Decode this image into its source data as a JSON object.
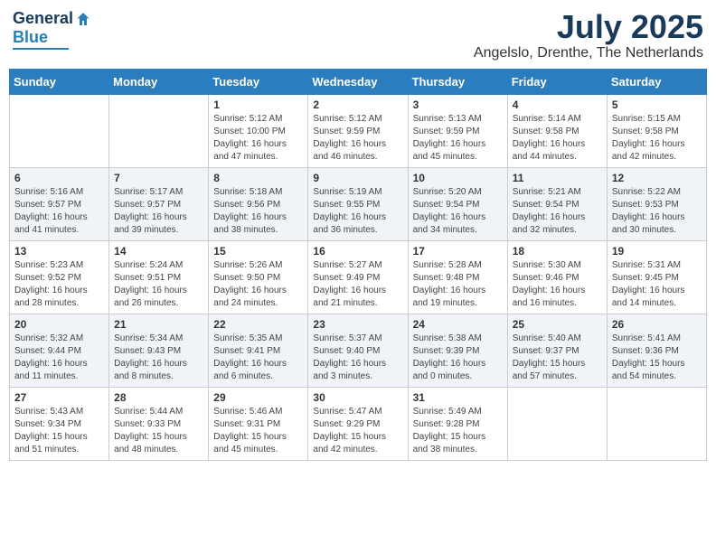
{
  "header": {
    "logo_general": "General",
    "logo_blue": "Blue",
    "month_title": "July 2025",
    "location": "Angelslo, Drenthe, The Netherlands"
  },
  "weekdays": [
    "Sunday",
    "Monday",
    "Tuesday",
    "Wednesday",
    "Thursday",
    "Friday",
    "Saturday"
  ],
  "weeks": [
    [
      {
        "day": "",
        "info": ""
      },
      {
        "day": "",
        "info": ""
      },
      {
        "day": "1",
        "info": "Sunrise: 5:12 AM\nSunset: 10:00 PM\nDaylight: 16 hours\nand 47 minutes."
      },
      {
        "day": "2",
        "info": "Sunrise: 5:12 AM\nSunset: 9:59 PM\nDaylight: 16 hours\nand 46 minutes."
      },
      {
        "day": "3",
        "info": "Sunrise: 5:13 AM\nSunset: 9:59 PM\nDaylight: 16 hours\nand 45 minutes."
      },
      {
        "day": "4",
        "info": "Sunrise: 5:14 AM\nSunset: 9:58 PM\nDaylight: 16 hours\nand 44 minutes."
      },
      {
        "day": "5",
        "info": "Sunrise: 5:15 AM\nSunset: 9:58 PM\nDaylight: 16 hours\nand 42 minutes."
      }
    ],
    [
      {
        "day": "6",
        "info": "Sunrise: 5:16 AM\nSunset: 9:57 PM\nDaylight: 16 hours\nand 41 minutes."
      },
      {
        "day": "7",
        "info": "Sunrise: 5:17 AM\nSunset: 9:57 PM\nDaylight: 16 hours\nand 39 minutes."
      },
      {
        "day": "8",
        "info": "Sunrise: 5:18 AM\nSunset: 9:56 PM\nDaylight: 16 hours\nand 38 minutes."
      },
      {
        "day": "9",
        "info": "Sunrise: 5:19 AM\nSunset: 9:55 PM\nDaylight: 16 hours\nand 36 minutes."
      },
      {
        "day": "10",
        "info": "Sunrise: 5:20 AM\nSunset: 9:54 PM\nDaylight: 16 hours\nand 34 minutes."
      },
      {
        "day": "11",
        "info": "Sunrise: 5:21 AM\nSunset: 9:54 PM\nDaylight: 16 hours\nand 32 minutes."
      },
      {
        "day": "12",
        "info": "Sunrise: 5:22 AM\nSunset: 9:53 PM\nDaylight: 16 hours\nand 30 minutes."
      }
    ],
    [
      {
        "day": "13",
        "info": "Sunrise: 5:23 AM\nSunset: 9:52 PM\nDaylight: 16 hours\nand 28 minutes."
      },
      {
        "day": "14",
        "info": "Sunrise: 5:24 AM\nSunset: 9:51 PM\nDaylight: 16 hours\nand 26 minutes."
      },
      {
        "day": "15",
        "info": "Sunrise: 5:26 AM\nSunset: 9:50 PM\nDaylight: 16 hours\nand 24 minutes."
      },
      {
        "day": "16",
        "info": "Sunrise: 5:27 AM\nSunset: 9:49 PM\nDaylight: 16 hours\nand 21 minutes."
      },
      {
        "day": "17",
        "info": "Sunrise: 5:28 AM\nSunset: 9:48 PM\nDaylight: 16 hours\nand 19 minutes."
      },
      {
        "day": "18",
        "info": "Sunrise: 5:30 AM\nSunset: 9:46 PM\nDaylight: 16 hours\nand 16 minutes."
      },
      {
        "day": "19",
        "info": "Sunrise: 5:31 AM\nSunset: 9:45 PM\nDaylight: 16 hours\nand 14 minutes."
      }
    ],
    [
      {
        "day": "20",
        "info": "Sunrise: 5:32 AM\nSunset: 9:44 PM\nDaylight: 16 hours\nand 11 minutes."
      },
      {
        "day": "21",
        "info": "Sunrise: 5:34 AM\nSunset: 9:43 PM\nDaylight: 16 hours\nand 8 minutes."
      },
      {
        "day": "22",
        "info": "Sunrise: 5:35 AM\nSunset: 9:41 PM\nDaylight: 16 hours\nand 6 minutes."
      },
      {
        "day": "23",
        "info": "Sunrise: 5:37 AM\nSunset: 9:40 PM\nDaylight: 16 hours\nand 3 minutes."
      },
      {
        "day": "24",
        "info": "Sunrise: 5:38 AM\nSunset: 9:39 PM\nDaylight: 16 hours\nand 0 minutes."
      },
      {
        "day": "25",
        "info": "Sunrise: 5:40 AM\nSunset: 9:37 PM\nDaylight: 15 hours\nand 57 minutes."
      },
      {
        "day": "26",
        "info": "Sunrise: 5:41 AM\nSunset: 9:36 PM\nDaylight: 15 hours\nand 54 minutes."
      }
    ],
    [
      {
        "day": "27",
        "info": "Sunrise: 5:43 AM\nSunset: 9:34 PM\nDaylight: 15 hours\nand 51 minutes."
      },
      {
        "day": "28",
        "info": "Sunrise: 5:44 AM\nSunset: 9:33 PM\nDaylight: 15 hours\nand 48 minutes."
      },
      {
        "day": "29",
        "info": "Sunrise: 5:46 AM\nSunset: 9:31 PM\nDaylight: 15 hours\nand 45 minutes."
      },
      {
        "day": "30",
        "info": "Sunrise: 5:47 AM\nSunset: 9:29 PM\nDaylight: 15 hours\nand 42 minutes."
      },
      {
        "day": "31",
        "info": "Sunrise: 5:49 AM\nSunset: 9:28 PM\nDaylight: 15 hours\nand 38 minutes."
      },
      {
        "day": "",
        "info": ""
      },
      {
        "day": "",
        "info": ""
      }
    ]
  ]
}
